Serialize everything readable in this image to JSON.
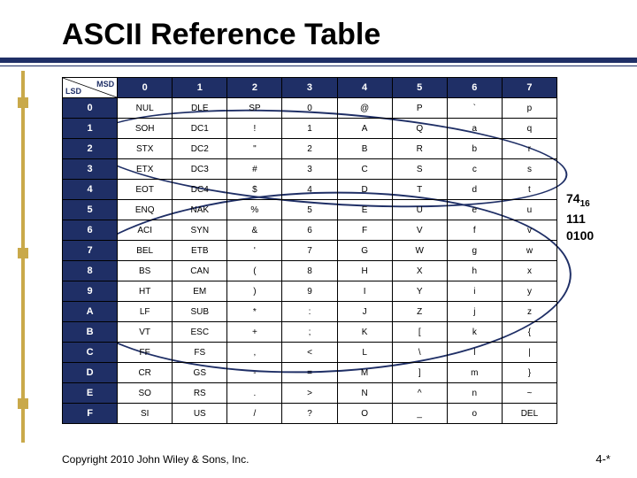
{
  "title": "ASCII Reference Table",
  "corner": {
    "msd": "MSD",
    "lsd": "LSD"
  },
  "col_headers": [
    "0",
    "1",
    "2",
    "3",
    "4",
    "5",
    "6",
    "7"
  ],
  "rows": [
    {
      "h": "0",
      "c": [
        "NUL",
        "DLE",
        "SP",
        "0",
        "@",
        "P",
        "`",
        "p"
      ]
    },
    {
      "h": "1",
      "c": [
        "SOH",
        "DC1",
        "!",
        "1",
        "A",
        "Q",
        "a",
        "q"
      ]
    },
    {
      "h": "2",
      "c": [
        "STX",
        "DC2",
        "\"",
        "2",
        "B",
        "R",
        "b",
        "r"
      ]
    },
    {
      "h": "3",
      "c": [
        "ETX",
        "DC3",
        "#",
        "3",
        "C",
        "S",
        "c",
        "s"
      ]
    },
    {
      "h": "4",
      "c": [
        "EOT",
        "DC4",
        "$",
        "4",
        "D",
        "T",
        "d",
        "t"
      ]
    },
    {
      "h": "5",
      "c": [
        "ENQ",
        "NAK",
        "%",
        "5",
        "E",
        "U",
        "e",
        "u"
      ]
    },
    {
      "h": "6",
      "c": [
        "ACI",
        "SYN",
        "&",
        "6",
        "F",
        "V",
        "f",
        "v"
      ]
    },
    {
      "h": "7",
      "c": [
        "BEL",
        "ETB",
        "'",
        "7",
        "G",
        "W",
        "g",
        "w"
      ]
    },
    {
      "h": "8",
      "c": [
        "BS",
        "CAN",
        "(",
        "8",
        "H",
        "X",
        "h",
        "x"
      ]
    },
    {
      "h": "9",
      "c": [
        "HT",
        "EM",
        ")",
        "9",
        "I",
        "Y",
        "i",
        "y"
      ]
    },
    {
      "h": "A",
      "c": [
        "LF",
        "SUB",
        "*",
        ":",
        "J",
        "Z",
        "j",
        "z"
      ]
    },
    {
      "h": "B",
      "c": [
        "VT",
        "ESC",
        "+",
        ";",
        "K",
        "[",
        "k",
        "{"
      ]
    },
    {
      "h": "C",
      "c": [
        "FF",
        "FS",
        ",",
        "<",
        "L",
        "\\",
        "l",
        "|"
      ]
    },
    {
      "h": "D",
      "c": [
        "CR",
        "GS",
        "-",
        "=",
        "M",
        "]",
        "m",
        "}"
      ]
    },
    {
      "h": "E",
      "c": [
        "SO",
        "RS",
        ".",
        ">",
        "N",
        "^",
        "n",
        "~"
      ]
    },
    {
      "h": "F",
      "c": [
        "SI",
        "US",
        "/",
        "?",
        "O",
        "_",
        "o",
        "DEL"
      ]
    }
  ],
  "notes": {
    "hex": "74",
    "hex_sub": "16",
    "bin": "111 0100"
  },
  "copyright": "Copyright 2010 John Wiley & Sons, Inc.",
  "pagenum": "4-*"
}
